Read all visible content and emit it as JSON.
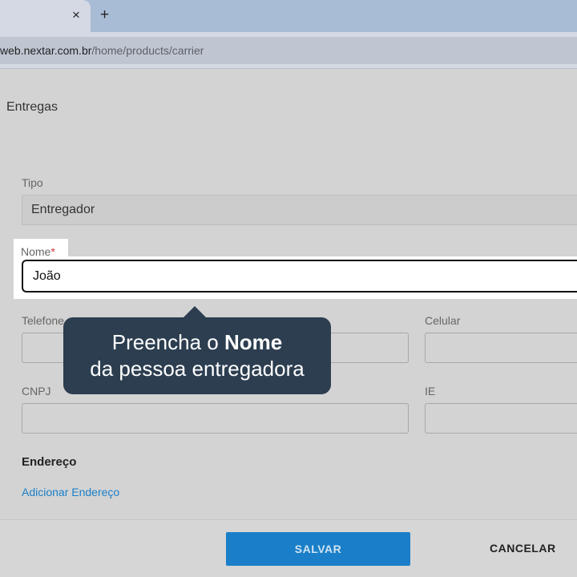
{
  "browser": {
    "tab_close_icon": "×",
    "new_tab_icon": "+",
    "url_host": "web.nextar.com.br",
    "url_path": "/home/products/carrier"
  },
  "page": {
    "title": "Entregas"
  },
  "form": {
    "tipo_label": "Tipo",
    "tipo_value": "Entregador",
    "nome_label": "Nome",
    "nome_required": "*",
    "nome_value": "João",
    "telefone_label": "Telefone",
    "celular_label": "Celular",
    "cnpj_label": "CNPJ",
    "ie_label": "IE",
    "endereco_title": "Endereço",
    "add_address_link": "Adicionar Endereço"
  },
  "tooltip": {
    "line1_prefix": "Preencha o ",
    "line1_bold": "Nome",
    "line2": "da pessoa entregadora"
  },
  "footer": {
    "save_label": "SALVAR",
    "cancel_label": "CANCELAR"
  },
  "colors": {
    "accent": "#1a7fc8",
    "tooltip_bg": "#2c3e50",
    "required": "#d23333"
  }
}
